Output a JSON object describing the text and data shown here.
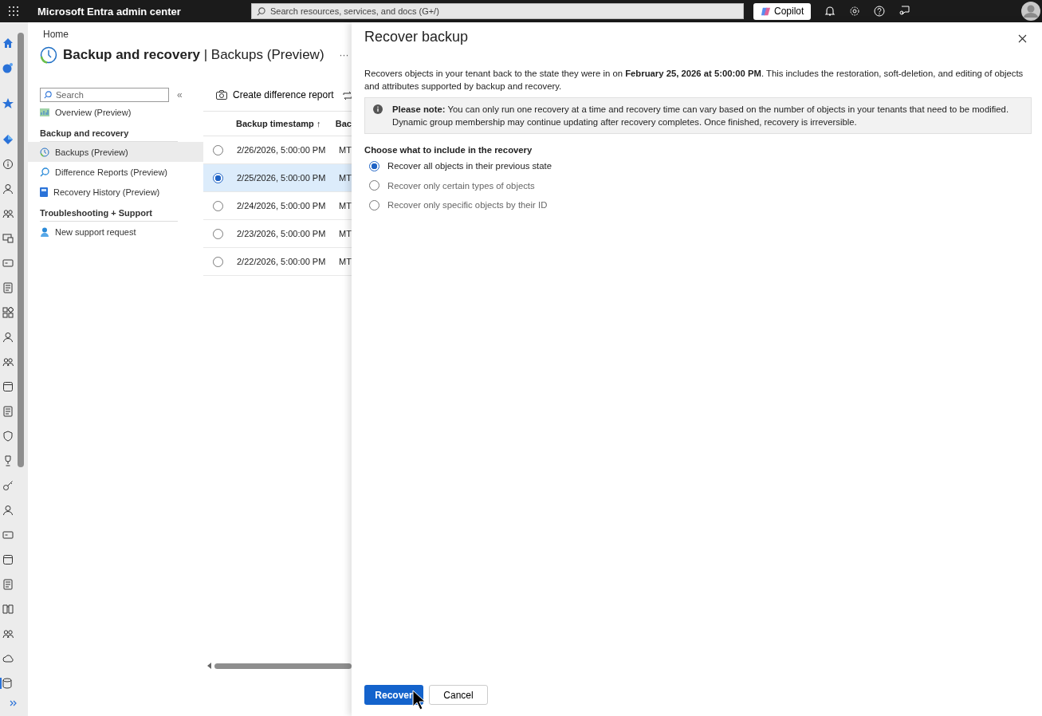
{
  "top_bar": {
    "title": "Microsoft Entra admin center",
    "search": {
      "placeholder": "Search resources, services, and docs (G+/)"
    },
    "copilot": "Copilot"
  },
  "breadcrumb": "Home",
  "page_title": "**Backup and recovery** | Backups (Preview)",
  "more": "···",
  "menu": {
    "search": {
      "placeholder": "Search"
    },
    "collapse": "«",
    "top_item": {
      "label": "Overview (Preview)",
      "selected": false
    },
    "sections": [
      {
        "heading": "Backup and recovery",
        "items": [
          {
            "label": "Backups (Preview)",
            "selected": true,
            "kind": "clock"
          },
          {
            "label": "Difference Reports (Preview)",
            "selected": false,
            "kind": "search"
          },
          {
            "label": "Recovery History (Preview)",
            "selected": false,
            "kind": "book"
          }
        ]
      },
      {
        "heading": "Troubleshooting + Support",
        "items": [
          {
            "label": "New support request",
            "selected": false,
            "kind": "person"
          }
        ]
      }
    ]
  },
  "toolbar": {
    "button": "Create difference report"
  },
  "table": {
    "columns": [
      "Backup timestamp",
      "Bac"
    ],
    "sort_arrow": "↑",
    "rows": [
      {
        "timestamp": "2/26/2026, 5:00:00 PM",
        "column_2": "MT",
        "selected": false
      },
      {
        "timestamp": "2/25/2026, 5:00:00 PM",
        "column_2": "MT",
        "selected": true
      },
      {
        "timestamp": "2/24/2026, 5:00:00 PM",
        "column_2": "MT",
        "selected": false
      },
      {
        "timestamp": "2/23/2026, 5:00:00 PM",
        "column_2": "MT",
        "selected": false
      },
      {
        "timestamp": "2/22/2026, 5:00:00 PM",
        "column_2": "MT",
        "selected": false
      }
    ]
  },
  "panel": {
    "title": "Recover backup",
    "description": "Recovers objects in your tenant back to the state they were in on **February 25, 2026 at 5:00:00 PM**. This includes the restoration, soft-deletion, and editing of objects and attributes supported by backup and recovery.",
    "note": "**Please note:** You can only run one recovery at a time and recovery time can vary based on the number of objects in your tenants that need to be modified. Dynamic group membership may continue updating after recovery completes. Once finished, recovery is irreversible.",
    "options_heading": "Choose what to include in the recovery",
    "options": [
      {
        "label": "Recover all objects in their previous state",
        "selected": true
      },
      {
        "label": "Recover only certain types of objects",
        "selected": false
      },
      {
        "label": "Recover only specific objects by their ID",
        "selected": false
      }
    ],
    "buttons": [
      {
        "label": "Recover",
        "kind": "primary"
      },
      {
        "label": "Cancel",
        "kind": "secondary"
      }
    ]
  }
}
